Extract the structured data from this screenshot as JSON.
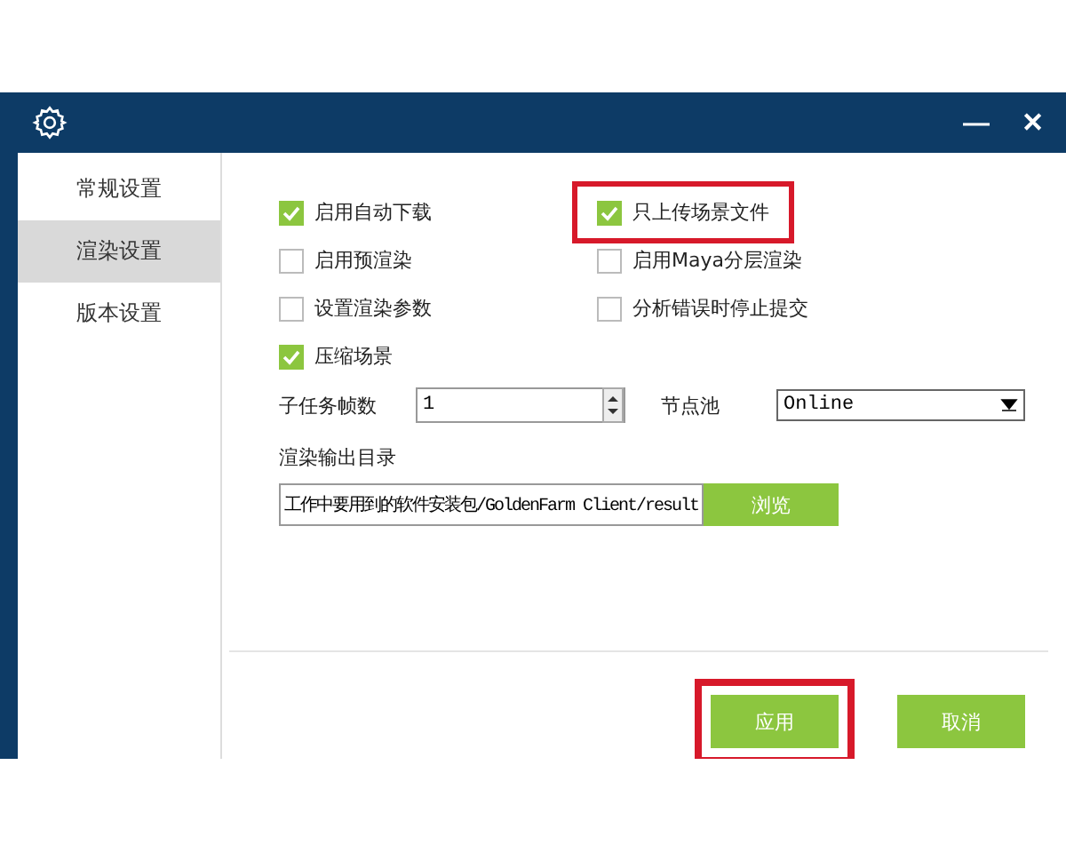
{
  "window": {
    "controls": [
      "—",
      "✕"
    ]
  },
  "sidebar": {
    "items": [
      {
        "label": "常规设置",
        "selected": false
      },
      {
        "label": "渲染设置",
        "selected": true
      },
      {
        "label": "版本设置",
        "selected": false
      }
    ]
  },
  "options": [
    {
      "label": "启用自动下载",
      "checked": true,
      "highlighted": false
    },
    {
      "label": "只上传场景文件",
      "checked": true,
      "highlighted": true
    },
    {
      "label": "启用预渲染",
      "checked": false,
      "highlighted": false
    },
    {
      "label": "启用Maya分层渲染",
      "checked": false,
      "highlighted": false
    },
    {
      "label": "设置渲染参数",
      "checked": false,
      "highlighted": false
    },
    {
      "label": "分析错误时停止提交",
      "checked": false,
      "highlighted": false
    },
    {
      "label": "压缩场景",
      "checked": true,
      "highlighted": false
    }
  ],
  "frame_count": {
    "label": "子任务帧数",
    "value": "1"
  },
  "node_pool": {
    "label": "节点池",
    "value": "Online"
  },
  "output_dir": {
    "label": "渲染输出目录",
    "value": "工作中要用到的软件安装包/GoldenFarm Client/result",
    "browse": "浏览"
  },
  "buttons": [
    {
      "label": "应用",
      "highlighted": true
    },
    {
      "label": "取消",
      "highlighted": false
    }
  ]
}
